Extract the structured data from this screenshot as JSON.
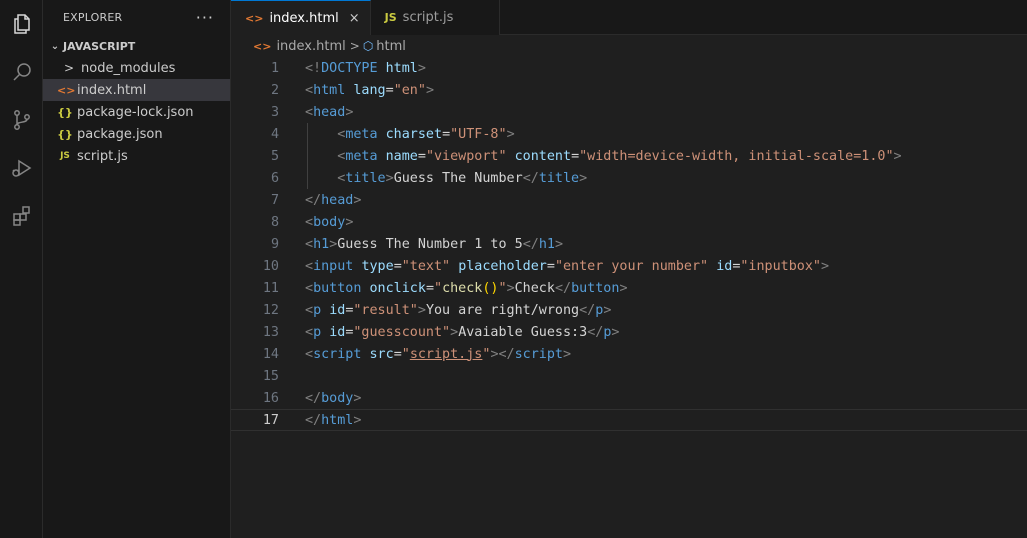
{
  "activity_bar": {
    "icons": [
      "files-icon",
      "search-icon",
      "source-control-icon",
      "run-debug-icon",
      "extensions-icon"
    ]
  },
  "sidebar": {
    "title": "EXPLORER",
    "more": "···",
    "section_title": "JAVASCRIPT",
    "items": [
      {
        "label": "node_modules",
        "icon": ">",
        "type": "folder"
      },
      {
        "label": "index.html",
        "icon": "<>",
        "type": "html",
        "selected": true
      },
      {
        "label": "package-lock.json",
        "icon": "{}",
        "type": "json"
      },
      {
        "label": "package.json",
        "icon": "{}",
        "type": "json"
      },
      {
        "label": "script.js",
        "icon": "JS",
        "type": "js"
      }
    ]
  },
  "tabs": [
    {
      "label": "index.html",
      "icon": "<>",
      "active": true,
      "close": "×"
    },
    {
      "label": "script.js",
      "icon": "JS",
      "active": false
    }
  ],
  "breadcrumb": {
    "file": "index.html",
    "separator": ">",
    "symbol": "html"
  },
  "editor": {
    "current_line": 17,
    "lines": [
      [
        [
          "t-br",
          "<!"
        ],
        [
          "t-tag",
          "DOCTYPE"
        ],
        [
          "t-txt",
          " "
        ],
        [
          "t-attr",
          "html"
        ],
        [
          "t-br",
          ">"
        ]
      ],
      [
        [
          "t-br",
          "<"
        ],
        [
          "t-tag",
          "html"
        ],
        [
          "t-txt",
          " "
        ],
        [
          "t-attr",
          "lang"
        ],
        [
          "t-txt",
          "="
        ],
        [
          "t-str",
          "\"en\""
        ],
        [
          "t-br",
          ">"
        ]
      ],
      [
        [
          "t-br",
          "<"
        ],
        [
          "t-tag",
          "head"
        ],
        [
          "t-br",
          ">"
        ]
      ],
      [
        [
          "t-txt",
          "    "
        ],
        [
          "t-br",
          "<"
        ],
        [
          "t-tag",
          "meta"
        ],
        [
          "t-txt",
          " "
        ],
        [
          "t-attr",
          "charset"
        ],
        [
          "t-txt",
          "="
        ],
        [
          "t-str",
          "\"UTF-8\""
        ],
        [
          "t-br",
          ">"
        ]
      ],
      [
        [
          "t-txt",
          "    "
        ],
        [
          "t-br",
          "<"
        ],
        [
          "t-tag",
          "meta"
        ],
        [
          "t-txt",
          " "
        ],
        [
          "t-attr",
          "name"
        ],
        [
          "t-txt",
          "="
        ],
        [
          "t-str",
          "\"viewport\""
        ],
        [
          "t-txt",
          " "
        ],
        [
          "t-attr",
          "content"
        ],
        [
          "t-txt",
          "="
        ],
        [
          "t-str",
          "\"width=device-width, initial-scale=1.0\""
        ],
        [
          "t-br",
          ">"
        ]
      ],
      [
        [
          "t-txt",
          "    "
        ],
        [
          "t-br",
          "<"
        ],
        [
          "t-tag",
          "title"
        ],
        [
          "t-br",
          ">"
        ],
        [
          "t-txt",
          "Guess The Number"
        ],
        [
          "t-br",
          "</"
        ],
        [
          "t-tag",
          "title"
        ],
        [
          "t-br",
          ">"
        ]
      ],
      [
        [
          "t-br",
          "</"
        ],
        [
          "t-tag",
          "head"
        ],
        [
          "t-br",
          ">"
        ]
      ],
      [
        [
          "t-br",
          "<"
        ],
        [
          "t-tag",
          "body"
        ],
        [
          "t-br",
          ">"
        ]
      ],
      [
        [
          "t-br",
          "<"
        ],
        [
          "t-tag",
          "h1"
        ],
        [
          "t-br",
          ">"
        ],
        [
          "t-txt",
          "Guess The Number 1 to 5"
        ],
        [
          "t-br",
          "</"
        ],
        [
          "t-tag",
          "h1"
        ],
        [
          "t-br",
          ">"
        ]
      ],
      [
        [
          "t-br",
          "<"
        ],
        [
          "t-tag",
          "input"
        ],
        [
          "t-txt",
          " "
        ],
        [
          "t-attr",
          "type"
        ],
        [
          "t-txt",
          "="
        ],
        [
          "t-str",
          "\"text\""
        ],
        [
          "t-txt",
          " "
        ],
        [
          "t-attr",
          "placeholder"
        ],
        [
          "t-txt",
          "="
        ],
        [
          "t-str",
          "\"enter your number\""
        ],
        [
          "t-txt",
          " "
        ],
        [
          "t-attr",
          "id"
        ],
        [
          "t-txt",
          "="
        ],
        [
          "t-str",
          "\"inputbox\""
        ],
        [
          "t-br",
          ">"
        ]
      ],
      [
        [
          "t-br",
          "<"
        ],
        [
          "t-tag",
          "button"
        ],
        [
          "t-txt",
          " "
        ],
        [
          "t-attr",
          "onclick"
        ],
        [
          "t-txt",
          "="
        ],
        [
          "t-str",
          "\""
        ],
        [
          "t-fn",
          "check"
        ],
        [
          "t-paren",
          "()"
        ],
        [
          "t-str",
          "\""
        ],
        [
          "t-br",
          ">"
        ],
        [
          "t-txt",
          "Check"
        ],
        [
          "t-br",
          "</"
        ],
        [
          "t-tag",
          "button"
        ],
        [
          "t-br",
          ">"
        ]
      ],
      [
        [
          "t-br",
          "<"
        ],
        [
          "t-tag",
          "p"
        ],
        [
          "t-txt",
          " "
        ],
        [
          "t-attr",
          "id"
        ],
        [
          "t-txt",
          "="
        ],
        [
          "t-str",
          "\"result\""
        ],
        [
          "t-br",
          ">"
        ],
        [
          "t-txt",
          "You are right/wrong"
        ],
        [
          "t-br",
          "</"
        ],
        [
          "t-tag",
          "p"
        ],
        [
          "t-br",
          ">"
        ]
      ],
      [
        [
          "t-br",
          "<"
        ],
        [
          "t-tag",
          "p"
        ],
        [
          "t-txt",
          " "
        ],
        [
          "t-attr",
          "id"
        ],
        [
          "t-txt",
          "="
        ],
        [
          "t-str",
          "\"guesscount\""
        ],
        [
          "t-br",
          ">"
        ],
        [
          "t-txt",
          "Avaiable Guess:3"
        ],
        [
          "t-br",
          "</"
        ],
        [
          "t-tag",
          "p"
        ],
        [
          "t-br",
          ">"
        ]
      ],
      [
        [
          "t-br",
          "<"
        ],
        [
          "t-tag",
          "script"
        ],
        [
          "t-txt",
          " "
        ],
        [
          "t-attr",
          "src"
        ],
        [
          "t-txt",
          "="
        ],
        [
          "t-str",
          "\""
        ],
        [
          "t-link",
          "script.js"
        ],
        [
          "t-str",
          "\""
        ],
        [
          "t-br",
          "></"
        ],
        [
          "t-tag",
          "script"
        ],
        [
          "t-br",
          ">"
        ]
      ],
      [],
      [
        [
          "t-br",
          "</"
        ],
        [
          "t-tag",
          "body"
        ],
        [
          "t-br",
          ">"
        ]
      ],
      [
        [
          "t-br",
          "</"
        ],
        [
          "t-tag",
          "html"
        ],
        [
          "t-br",
          ">"
        ]
      ]
    ]
  }
}
